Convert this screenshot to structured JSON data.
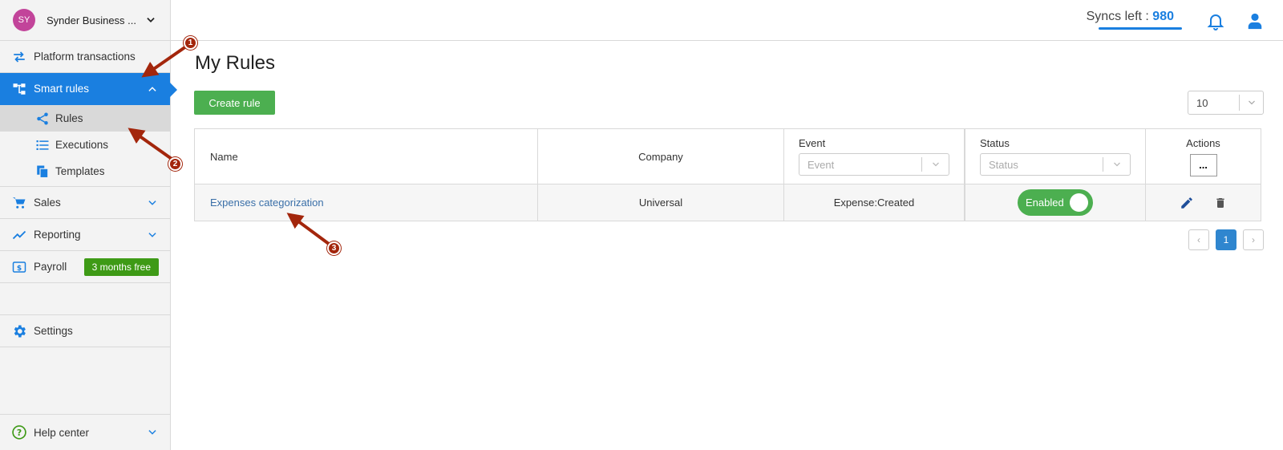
{
  "account": {
    "initials": "SY",
    "name": "Synder Business ..."
  },
  "sidebar": {
    "items": [
      {
        "label": "Platform transactions"
      },
      {
        "label": "Smart rules"
      },
      {
        "label": "Sales"
      },
      {
        "label": "Reporting"
      },
      {
        "label": "Payroll",
        "badge": "3 months free"
      },
      {
        "label": "Settings"
      }
    ],
    "smart_rules_sub": [
      {
        "label": "Rules"
      },
      {
        "label": "Executions"
      },
      {
        "label": "Templates"
      }
    ],
    "help": {
      "label": "Help center"
    }
  },
  "header": {
    "syncs_label": "Syncs left :",
    "syncs_count": "980"
  },
  "main": {
    "title": "My Rules",
    "create_label": "Create rule",
    "per_page": "10",
    "columns": {
      "name": "Name",
      "company": "Company",
      "event": "Event",
      "event_placeholder": "Event",
      "status": "Status",
      "status_placeholder": "Status",
      "actions": "Actions",
      "actions_more": "..."
    },
    "rows": [
      {
        "name": "Expenses categorization",
        "company": "Universal",
        "event": "Expense:Created",
        "status": "Enabled"
      }
    ],
    "pagination": {
      "prev": "‹",
      "current": "1",
      "next": "›"
    }
  },
  "annotations": {
    "m1": "1",
    "m2": "2",
    "m3": "3"
  },
  "colors": {
    "accent": "#1a7fe0",
    "create": "#4caf50",
    "badge": "#3e9a16",
    "annotation": "#a3260c"
  }
}
